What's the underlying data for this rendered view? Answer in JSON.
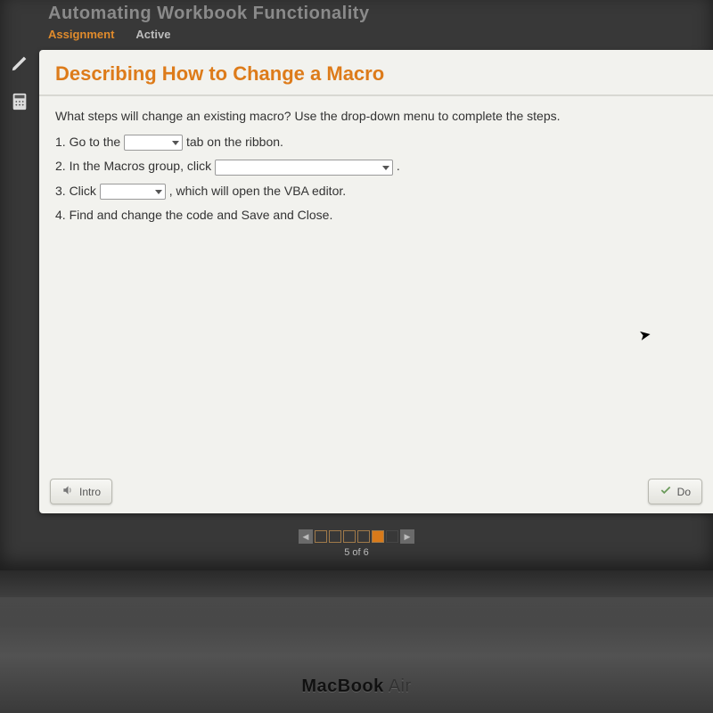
{
  "header": {
    "lesson_title": "Automating Workbook Functionality",
    "tab_assignment": "Assignment",
    "tab_active": "Active"
  },
  "content": {
    "title": "Describing How to Change a Macro",
    "prompt": "What steps will change an existing macro? Use the drop-down menu to complete the steps.",
    "step1_a": "1. Go to the ",
    "step1_b": " tab on the ribbon.",
    "step2_a": "2. In the Macros group, click ",
    "step2_b": ".",
    "step3_a": "3. Click ",
    "step3_b": ", which will open the VBA editor.",
    "step4": "4. Find and change the code and Save and Close."
  },
  "footer": {
    "intro_label": "Intro",
    "done_label": "Do"
  },
  "pager": {
    "text": "5 of 6"
  },
  "laptop": {
    "brand_bold": "MacBook",
    "brand_light": " Air"
  }
}
